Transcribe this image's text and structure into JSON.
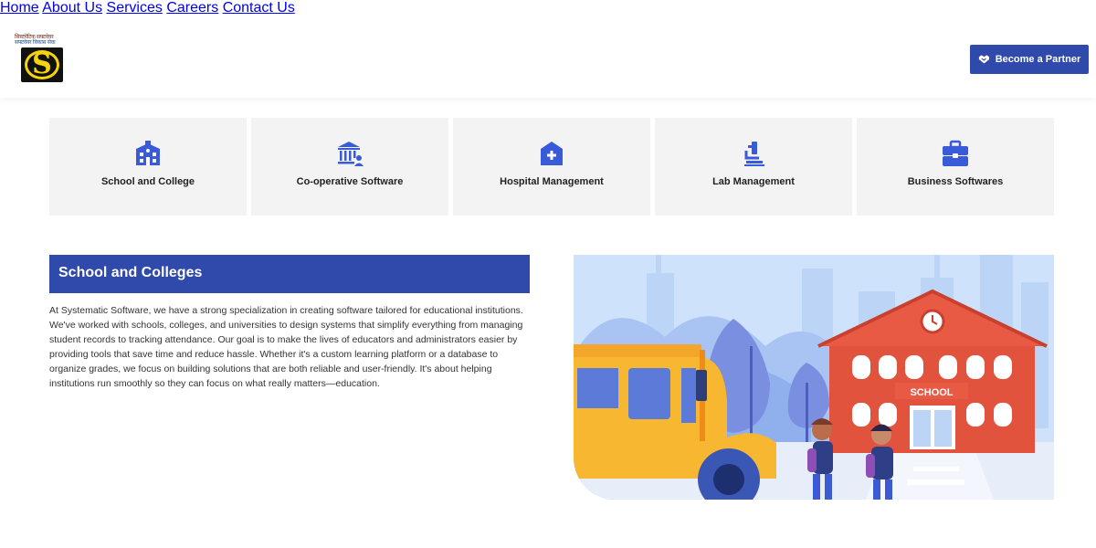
{
  "header": {
    "logo": {
      "tagline_line1": "सिस्टमेटिक सफ्टवेयर",
      "tagline_line2": "सफ्टवेयर विकास सेवा",
      "mark_text": "S"
    },
    "nav": [
      {
        "label": "Home"
      },
      {
        "label": "About Us"
      },
      {
        "label": "Services"
      },
      {
        "label": "Careers"
      },
      {
        "label": "Contact Us"
      }
    ],
    "cta": {
      "label": "Become a Partner",
      "icon": "handshake-icon"
    }
  },
  "categories": [
    {
      "label": "School and College",
      "icon": "school-building-icon"
    },
    {
      "label": "Co-operative Software",
      "icon": "bank-user-icon"
    },
    {
      "label": "Hospital Management",
      "icon": "hospital-icon"
    },
    {
      "label": "Lab Management",
      "icon": "microscope-icon"
    },
    {
      "label": "Business Softwares",
      "icon": "briefcase-icon"
    }
  ],
  "section": {
    "title": "School and Colleges",
    "body": "At Systematic Software, we have a strong specialization in creating software tailored for educational institutions. We've worked with schools, colleges, and universities to design systems that simplify everything from managing student records to tracking attendance. Our goal is to make the lives of educators and administrators easier by providing tools that save time and reduce hassle. Whether it's a custom learning platform or a database to organize grades, we focus on building solutions that are both reliable and user-friendly. It's about helping institutions run smoothly so they can focus on what really matters—education.",
    "illustration": {
      "sign_text": "SCHOOL"
    }
  },
  "colors": {
    "brand_blue": "#2f4aab",
    "card_bg": "#f3f3f3",
    "icon_blue": "#3a5bd9",
    "logo_yellow": "#f6d40c"
  }
}
